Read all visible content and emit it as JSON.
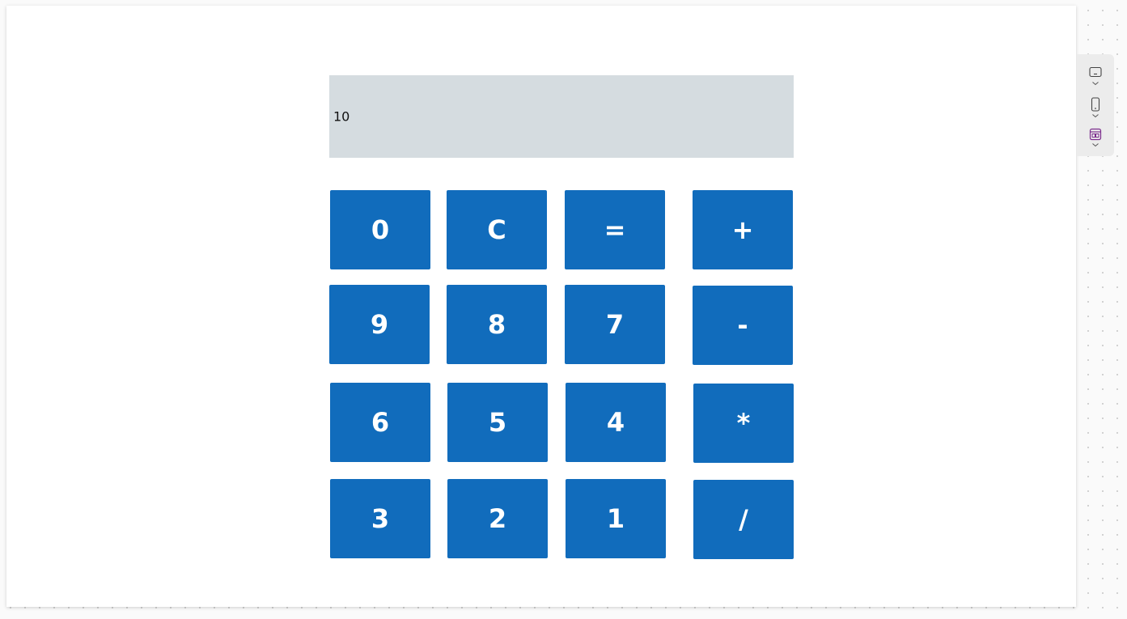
{
  "display": {
    "value": "10"
  },
  "keypad": {
    "rows": [
      [
        "0",
        "C",
        "=",
        "+"
      ],
      [
        "9",
        "8",
        "7",
        "-"
      ],
      [
        "6",
        "5",
        "4",
        "*"
      ],
      [
        "3",
        "2",
        "1",
        "/"
      ]
    ]
  },
  "toolbar": {
    "items": [
      {
        "icon": "desktop-view-icon"
      },
      {
        "icon": "mobile-view-icon"
      },
      {
        "icon": "tablet-layout-icon"
      }
    ]
  },
  "colors": {
    "key_background": "#116cbc",
    "key_text": "#ffffff",
    "display_background": "#d5dce0",
    "tablet_icon_accent": "#7b2c8c"
  }
}
